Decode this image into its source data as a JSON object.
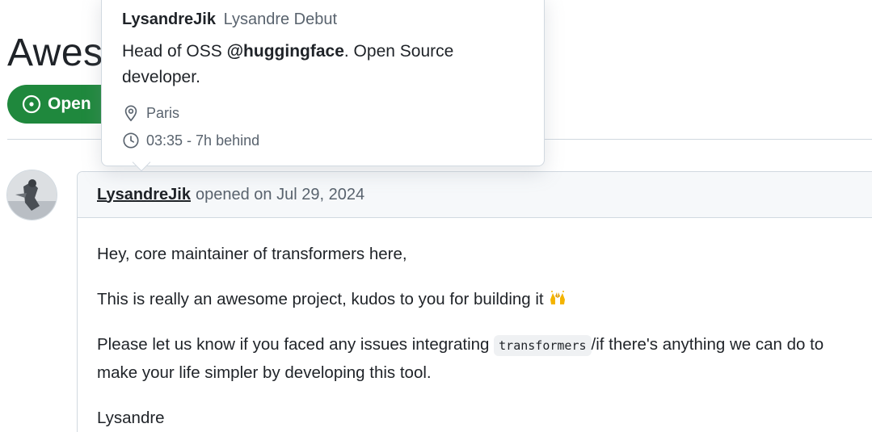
{
  "issue": {
    "title": "Awesome",
    "state_label": "Open",
    "state_color": "#1f883d"
  },
  "comment": {
    "author": "LysandreJik",
    "meta": "opened on Jul 29, 2024",
    "para1": "Hey, core maintainer of transformers here,",
    "para2": "This is really an awesome project, kudos to you for building it",
    "para3_before": "Please let us know if you faced any issues integrating",
    "para3_code": "transformers",
    "para3_after": "/if there's anything we can do to make your life simpler by developing this tool.",
    "signature": "Lysandre"
  },
  "hovercard": {
    "login": "LysandreJik",
    "name": "Lysandre Debut",
    "bio_before": "Head of OSS",
    "bio_mention": "@huggingface",
    "bio_after": ". Open Source developer.",
    "location": "Paris",
    "local_time": "03:35 - 7h behind"
  },
  "icons": {
    "state": "issue-opened-icon",
    "location": "location-pin-icon",
    "time": "clock-icon",
    "emoji": "raised-hands-emoji"
  }
}
